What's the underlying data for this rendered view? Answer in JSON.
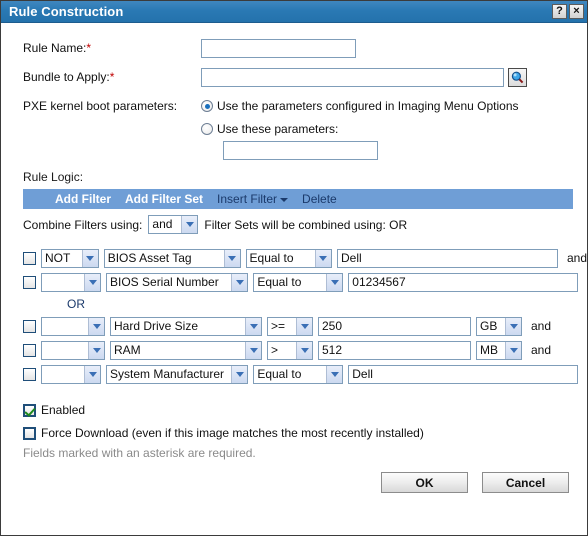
{
  "window": {
    "title": "Rule Construction",
    "help_button": "?",
    "close_button": "×"
  },
  "form": {
    "rule_name_label": "Rule Name:",
    "rule_name_value": "",
    "bundle_label": "Bundle to Apply:",
    "bundle_value": "",
    "browse_icon": "magnifier-icon",
    "pxe_label": "PXE kernel boot parameters:",
    "pxe_option_configured": "Use the parameters configured in Imaging Menu Options",
    "pxe_option_these": "Use these parameters:",
    "pxe_params_value": "",
    "required_marker": "*"
  },
  "rule_logic": {
    "section_label": "Rule Logic:",
    "toolbar": {
      "add_filter": "Add Filter",
      "add_filter_set": "Add Filter Set",
      "insert_filter": "Insert Filter",
      "delete": "Delete"
    },
    "combine_label": "Combine Filters using:",
    "combine_value": "and",
    "filter_sets_note": "Filter Sets will be combined using: OR",
    "set_separator": "OR",
    "rows": [
      {
        "negate": "NOT",
        "field": "BIOS Asset Tag",
        "operator": "Equal to",
        "value": "Dell",
        "unit": null,
        "conjunction": "and"
      },
      {
        "negate": "",
        "field": "BIOS Serial Number",
        "operator": "Equal to",
        "value": "01234567",
        "unit": null,
        "conjunction": ""
      },
      {
        "negate": "",
        "field": "Hard Drive Size",
        "operator": ">=",
        "value": "250",
        "unit": "GB",
        "conjunction": "and"
      },
      {
        "negate": "",
        "field": "RAM",
        "operator": ">",
        "value": "512",
        "unit": "MB",
        "conjunction": "and"
      },
      {
        "negate": "",
        "field": "System Manufacturer",
        "operator": "Equal to",
        "value": "Dell",
        "unit": null,
        "conjunction": ""
      }
    ]
  },
  "footer": {
    "enabled_label": "Enabled",
    "force_download_label": "Force Download (even if this image matches the most recently installed)",
    "asterisk_note": "Fields marked with an asterisk are required.",
    "ok_label": "OK",
    "cancel_label": "Cancel"
  },
  "colors": {
    "title_blue": "#2a79b4",
    "toolbar_blue": "#6f9ed6",
    "toolbar_link": "#1b3a6b",
    "required_red": "#c00000",
    "check_green": "#1d8a1d"
  }
}
